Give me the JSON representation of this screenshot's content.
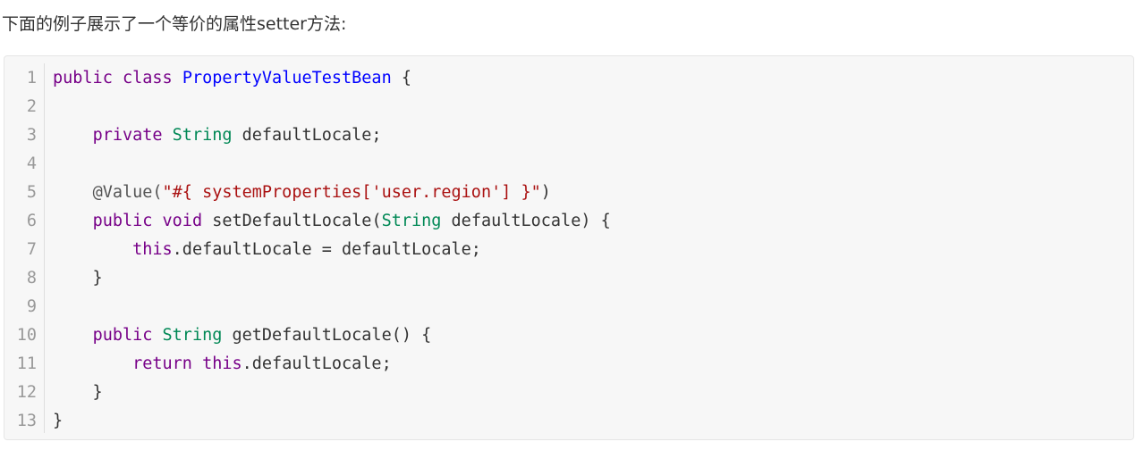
{
  "intro_text": "下面的例子展示了一个等价的属性setter方法:",
  "code": {
    "language": "java",
    "lines": [
      {
        "n": "1",
        "tokens": [
          {
            "t": "public",
            "c": "kw"
          },
          {
            "t": " ",
            "c": "plain"
          },
          {
            "t": "class",
            "c": "kw"
          },
          {
            "t": " ",
            "c": "plain"
          },
          {
            "t": "PropertyValueTestBean",
            "c": "cls"
          },
          {
            "t": " {",
            "c": "plain"
          }
        ]
      },
      {
        "n": "2",
        "tokens": []
      },
      {
        "n": "3",
        "tokens": [
          {
            "t": "    ",
            "c": "plain"
          },
          {
            "t": "private",
            "c": "kw"
          },
          {
            "t": " ",
            "c": "plain"
          },
          {
            "t": "String",
            "c": "ty"
          },
          {
            "t": " defaultLocale;",
            "c": "plain"
          }
        ]
      },
      {
        "n": "4",
        "tokens": []
      },
      {
        "n": "5",
        "tokens": [
          {
            "t": "    ",
            "c": "plain"
          },
          {
            "t": "@Value(",
            "c": "ann"
          },
          {
            "t": "\"#{ systemProperties['user.region'] }\"",
            "c": "str"
          },
          {
            "t": ")",
            "c": "plain"
          }
        ]
      },
      {
        "n": "6",
        "tokens": [
          {
            "t": "    ",
            "c": "plain"
          },
          {
            "t": "public",
            "c": "kw"
          },
          {
            "t": " ",
            "c": "plain"
          },
          {
            "t": "void",
            "c": "kw"
          },
          {
            "t": " setDefaultLocale(",
            "c": "plain"
          },
          {
            "t": "String",
            "c": "ty"
          },
          {
            "t": " defaultLocale) {",
            "c": "plain"
          }
        ]
      },
      {
        "n": "7",
        "tokens": [
          {
            "t": "        ",
            "c": "plain"
          },
          {
            "t": "this",
            "c": "kw"
          },
          {
            "t": ".defaultLocale = defaultLocale;",
            "c": "plain"
          }
        ]
      },
      {
        "n": "8",
        "tokens": [
          {
            "t": "    }",
            "c": "plain"
          }
        ]
      },
      {
        "n": "9",
        "tokens": []
      },
      {
        "n": "10",
        "tokens": [
          {
            "t": "    ",
            "c": "plain"
          },
          {
            "t": "public",
            "c": "kw"
          },
          {
            "t": " ",
            "c": "plain"
          },
          {
            "t": "String",
            "c": "ty"
          },
          {
            "t": " getDefaultLocale() {",
            "c": "plain"
          }
        ]
      },
      {
        "n": "11",
        "tokens": [
          {
            "t": "        ",
            "c": "plain"
          },
          {
            "t": "return",
            "c": "kw"
          },
          {
            "t": " ",
            "c": "plain"
          },
          {
            "t": "this",
            "c": "kw"
          },
          {
            "t": ".defaultLocale;",
            "c": "plain"
          }
        ]
      },
      {
        "n": "12",
        "tokens": [
          {
            "t": "    }",
            "c": "plain"
          }
        ]
      },
      {
        "n": "13",
        "tokens": [
          {
            "t": "}",
            "c": "plain"
          }
        ]
      }
    ]
  },
  "colors": {
    "keyword": "#770088",
    "type": "#008855",
    "class_name": "#0000ff",
    "string": "#aa1111",
    "plain": "#333333",
    "line_number": "#999999",
    "code_background": "#f7f7f7"
  }
}
